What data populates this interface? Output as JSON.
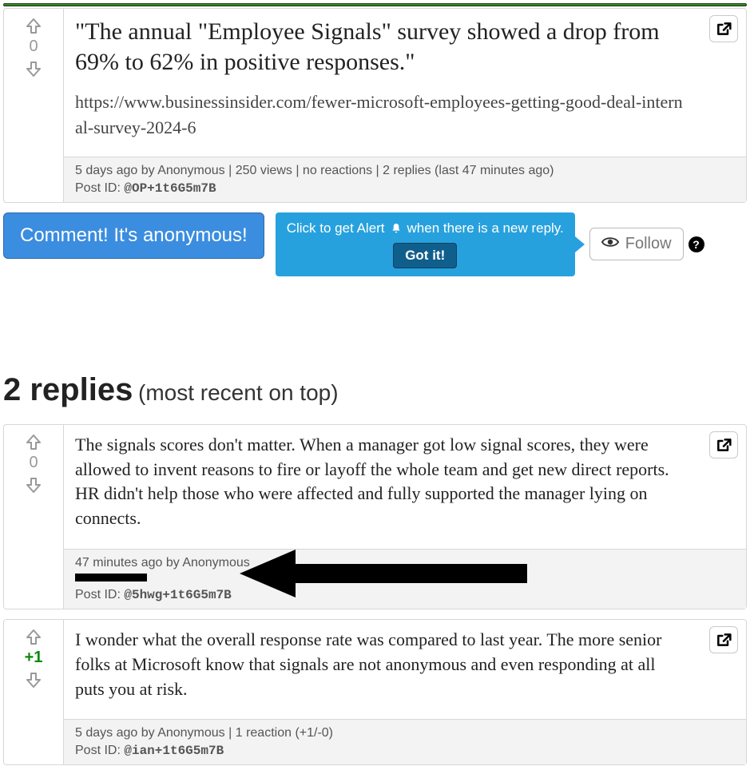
{
  "main_post": {
    "vote_score": "0",
    "quote": "\"The annual \"Employee Signals\" survey showed a drop from 69% to 62% in positive responses.\"",
    "url": "https://www.businessinsider.com/fewer-microsoft-employees-getting-good-deal-internal-survey-2024-6",
    "meta_line1": "5 days ago by Anonymous | 250 views | no reactions | 2 replies (last 47 minutes ago)",
    "post_id_label": "Post ID: ",
    "post_id": "@OP+1t6G5m7B"
  },
  "actions": {
    "comment_label": "Comment! It's anonymous!",
    "tooltip_pre": "Click to get Alert",
    "tooltip_post": "when there is a new reply.",
    "got_it": "Got it!",
    "follow_label": "Follow",
    "help": "?"
  },
  "replies_header": {
    "count_label": "2 replies",
    "sort_label": "(most recent on top)"
  },
  "replies": [
    {
      "vote_score": "0",
      "body": "The signals scores don't matter. When a manager got low signal scores, they were allowed to invent reasons to fire or layoff the whole team and get new direct reports. HR didn't help those who were affected and fully supported the manager lying on connects.",
      "meta_line1": "47 minutes ago by Anonymous",
      "post_id_label": "Post ID: ",
      "post_id": "@5hwg+1t6G5m7B"
    },
    {
      "vote_score": "+1",
      "body": "I wonder what the overall response rate was compared to last year. The more senior folks at Microsoft know that signals are not anonymous and even responding at all puts you at risk.",
      "meta_line1": "5 days ago by Anonymous | 1 reaction (+1/-0)",
      "post_id_label": "Post ID: ",
      "post_id": "@ian+1t6G5m7B"
    }
  ]
}
